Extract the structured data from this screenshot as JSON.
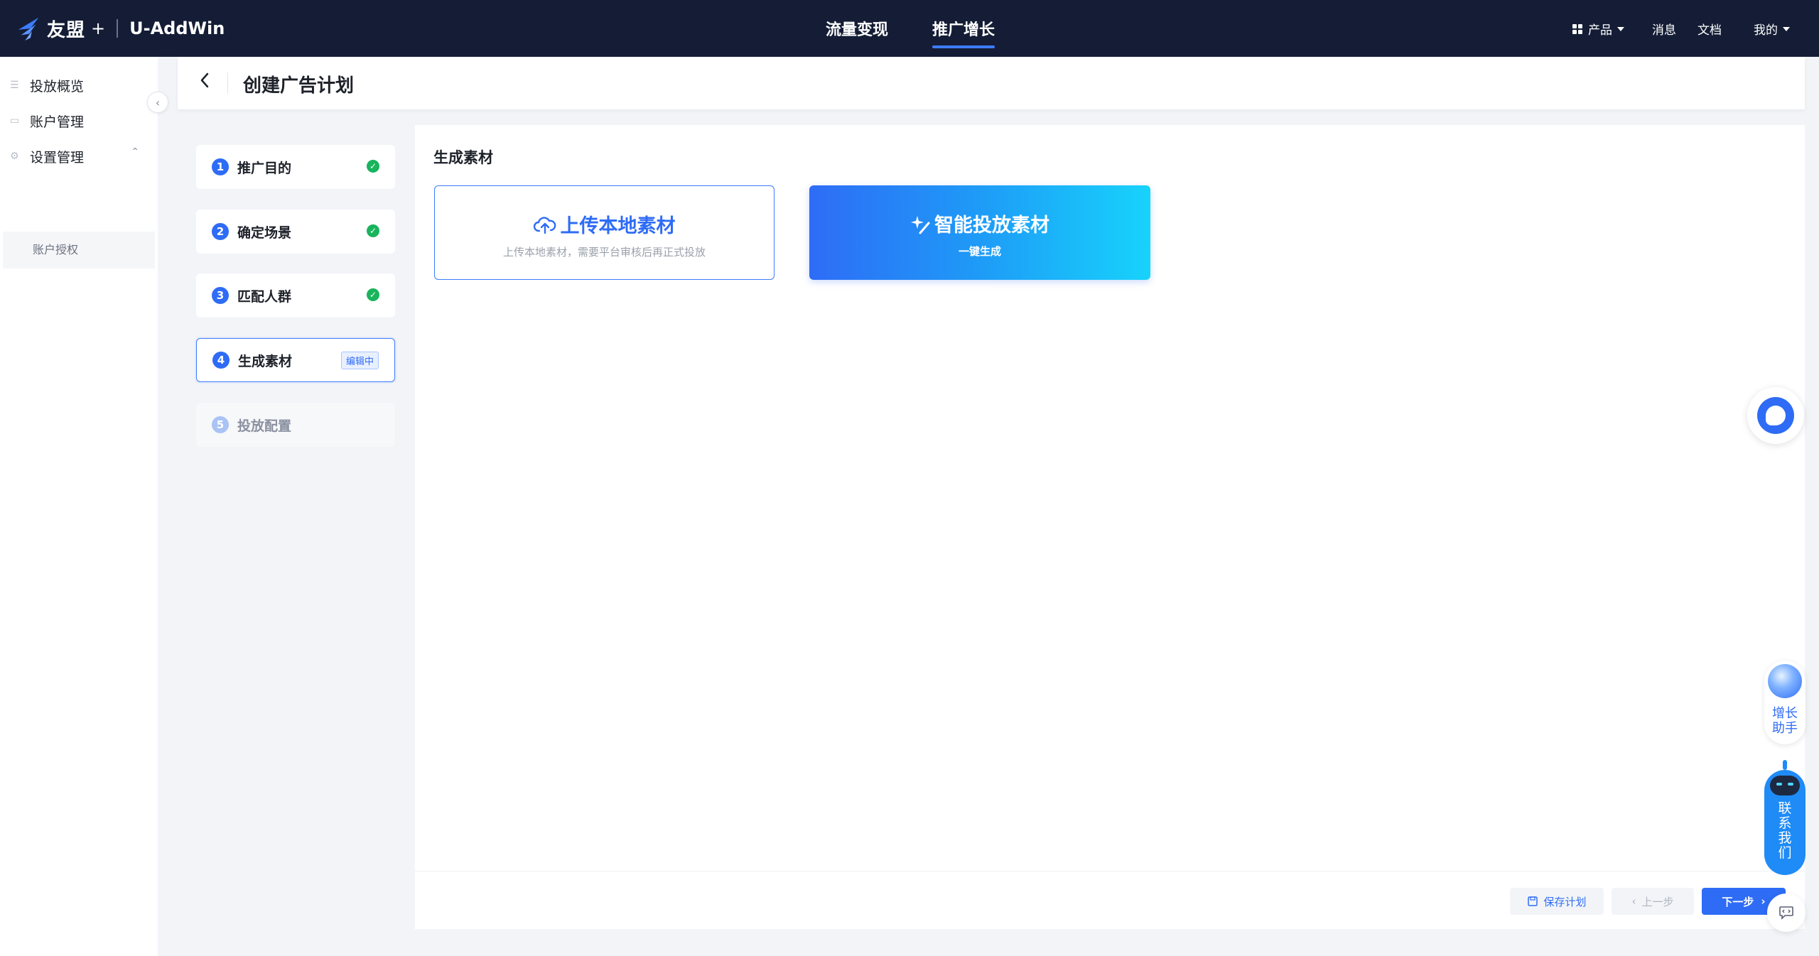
{
  "topbar": {
    "brand": "友盟",
    "brand_plus": "+",
    "product": "U-AddWin",
    "tabs": [
      {
        "label": "流量变现",
        "active": false
      },
      {
        "label": "推广增长",
        "active": true
      }
    ],
    "right": {
      "products": "产品",
      "messages": "消息",
      "docs": "文档",
      "mine": "我的"
    }
  },
  "sidebar": {
    "items": [
      {
        "label": "投放概览"
      },
      {
        "label": "账户管理"
      },
      {
        "label": "设置管理"
      }
    ],
    "sub_item": "账户授权"
  },
  "header": {
    "title": "创建广告计划"
  },
  "steps": [
    {
      "num": "1",
      "label": "推广目的",
      "status": "done"
    },
    {
      "num": "2",
      "label": "确定场景",
      "status": "done"
    },
    {
      "num": "3",
      "label": "匹配人群",
      "status": "done"
    },
    {
      "num": "4",
      "label": "生成素材",
      "status": "editing",
      "badge": "编辑中"
    },
    {
      "num": "5",
      "label": "投放配置",
      "status": "disabled"
    }
  ],
  "main": {
    "section_title": "生成素材",
    "upload": {
      "title": "上传本地素材",
      "desc": "上传本地素材，需要平台审核后再正式投放"
    },
    "ai": {
      "title": "智能投放素材",
      "sub": "一键生成"
    },
    "buttons": {
      "save": "保存计划",
      "prev": "上一步",
      "next": "下一步"
    }
  },
  "floating": {
    "assistant": "增长\n助手",
    "contact": "联\n系\n我\n们"
  },
  "colors": {
    "topbar_bg": "#141d35",
    "primary": "#2e6cf6",
    "success": "#19b45c"
  }
}
